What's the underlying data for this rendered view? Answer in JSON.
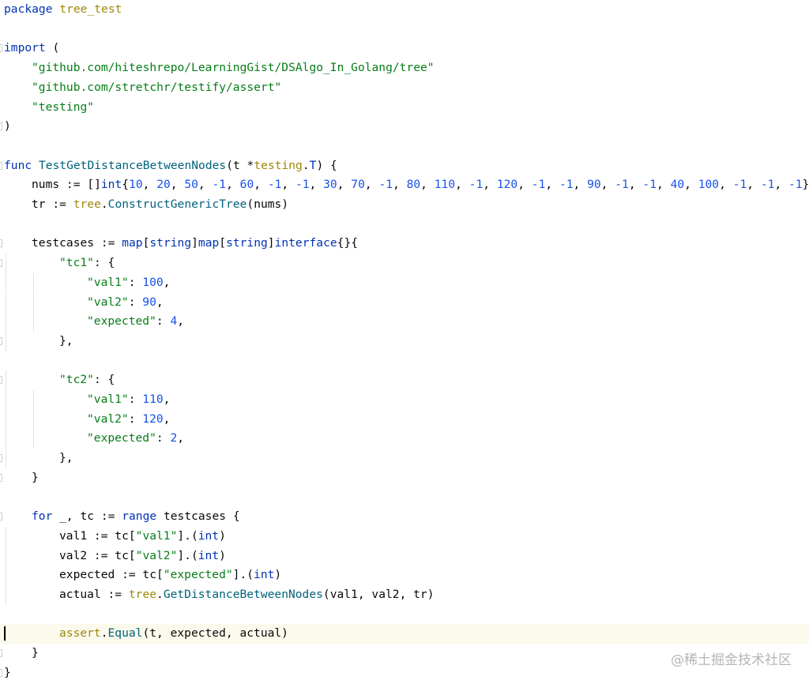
{
  "editor": {
    "lines": [
      "package tree_test",
      "",
      "import (",
      "\t\"github.com/hiteshrepo/LearningGist/DSAlgo_In_Golang/tree\"",
      "\t\"github.com/stretchr/testify/assert\"",
      "\t\"testing\"",
      ")",
      "",
      "func TestGetDistanceBetweenNodes(t *testing.T) {",
      "\tnums := []int{10, 20, 50, -1, 60, -1, -1, 30, 70, -1, 80, 110, -1, 120, -1, -1, 90, -1, -1, 40, 100, -1, -1, -1}",
      "\ttr := tree.ConstructGenericTree(nums)",
      "",
      "\ttestcases := map[string]map[string]interface{}{",
      "\t\t\"tc1\": {",
      "\t\t\t\"val1\": 100,",
      "\t\t\t\"val2\": 90,",
      "\t\t\t\"expected\": 4,",
      "\t\t},",
      "",
      "\t\t\"tc2\": {",
      "\t\t\t\"val1\": 110,",
      "\t\t\t\"val2\": 120,",
      "\t\t\t\"expected\": 2,",
      "\t\t},",
      "\t}",
      "",
      "\tfor _, tc := range testcases {",
      "\t\tval1 := tc[\"val1\"].(int)",
      "\t\tval2 := tc[\"val2\"].(int)",
      "\t\texpected := tc[\"expected\"].(int)",
      "\t\tactual := tree.GetDistanceBetweenNodes(val1, val2, tr)",
      "",
      "\t\tassert.Equal(t, expected, actual)",
      "\t}",
      "}"
    ],
    "current_line_index": 32
  },
  "watermark": "@稀土掘金技术社区",
  "colors": {
    "keyword": "#0033b3",
    "string": "#067d17",
    "number": "#1750eb",
    "package": "#9e880d",
    "function": "#00627a",
    "current_line": "#fcfaed"
  }
}
